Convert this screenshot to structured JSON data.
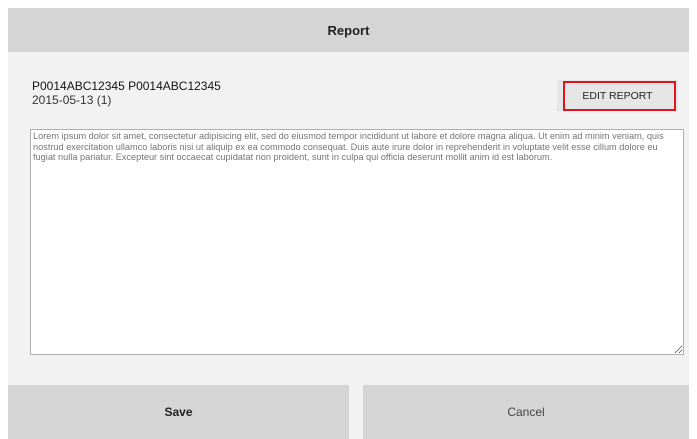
{
  "header": {
    "title": "Report"
  },
  "record": {
    "id_text": "P0014ABC12345 P0014ABC12345",
    "date_text": "2015-05-13 (1)"
  },
  "toolbar": {
    "edit_label": "EDIT REPORT"
  },
  "report": {
    "placeholder": "Lorem ipsum dolor sit amet, consectetur adipisicing elit, sed do eiusmod tempor incididunt ut labore et dolore magna aliqua. Ut enim ad minim veniam, quis nostrud exercitation ullamco laboris nisi ut aliquip ex ea commodo consequat. Duis aute irure dolor in reprehenderit in voluptate velit esse cillum dolore eu fugiat nulla pariatur. Excepteur sint occaecat cupidatat non proident, sunt in culpa qui officia deserunt mollit anim id est laborum.",
    "value": ""
  },
  "footer": {
    "save_label": "Save",
    "cancel_label": "Cancel"
  },
  "colors": {
    "highlight": "#e0141e",
    "header_bg": "#d5d5d5",
    "panel_bg": "#f2f2f2"
  }
}
